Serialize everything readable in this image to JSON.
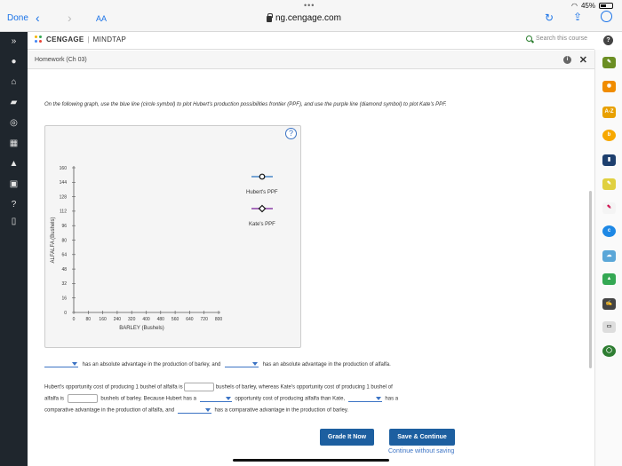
{
  "browser": {
    "done_label": "Done",
    "aa_label": "AA",
    "url": "ng.cengage.com",
    "battery": "45%"
  },
  "app": {
    "brand": "CENGAGE",
    "product": "MINDTAP",
    "search_placeholder": "Search this course",
    "page_title": "Homework (Ch 03)"
  },
  "content": {
    "instructions": "On the following graph, use the blue line (circle symbol) to plot Hubert's production possibilities frontier (PPF), and use the purple line (diamond symbol) to plot Kate's PPF.",
    "q1_part1": "has an absolute advantage in the production of barley, and",
    "q1_part2": "has an absolute advantage in the production of alfalfa.",
    "q2_part1": "Hubert's opportunity cost of producing 1 bushel of alfalfa is",
    "q2_part2": "bushels of barley, whereas Kate's opportunity cost of producing 1 bushel of",
    "q2_part3": "alfalfa is",
    "q2_part4": "bushels of barley. Because Hubert has a",
    "q2_part5": "opportunity cost of producing alfalfa than Kate,",
    "q2_part6": "has a",
    "q2_part7": "comparative advantage in the production of alfalfa, and",
    "q2_part8": "has a comparative advantage in the production of barley.",
    "grade_button": "Grade It Now",
    "save_button": "Save & Continue",
    "continue_link": "Continue without saving"
  },
  "chart_data": {
    "type": "line",
    "xlabel": "BARLEY (Bushels)",
    "ylabel": "ALFALFA (Bushels)",
    "xlim": [
      0,
      800
    ],
    "ylim": [
      0,
      160
    ],
    "x_ticks": [
      "0",
      "80",
      "160",
      "240",
      "320",
      "400",
      "480",
      "560",
      "640",
      "720",
      "800"
    ],
    "y_ticks": [
      "0",
      "16",
      "32",
      "48",
      "64",
      "80",
      "96",
      "112",
      "128",
      "144",
      "160"
    ],
    "legend": [
      {
        "name": "Hubert's PPF",
        "color": "#4a86c8",
        "marker": "circle"
      },
      {
        "name": "Kate's PPF",
        "color": "#8b3fa8",
        "marker": "diamond"
      }
    ],
    "series": [],
    "grid": false
  }
}
